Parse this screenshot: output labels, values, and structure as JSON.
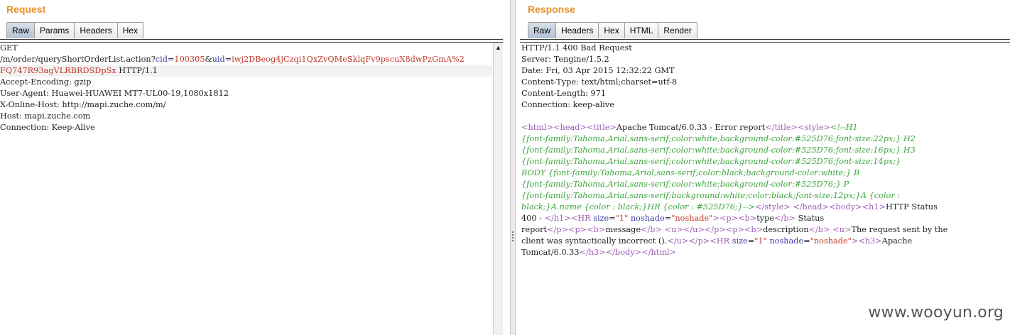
{
  "request": {
    "title": "Request",
    "tabs": [
      "Raw",
      "Params",
      "Headers",
      "Hex"
    ],
    "active_tab": "Raw",
    "line1": "GET",
    "path": "/m/order/queryShortOrderList.action?",
    "q1k": "cid",
    "q1v": "100305",
    "amp": "&",
    "eq": "=",
    "q2k": "uid",
    "q2v_part1": "iwj2DBeog4jCzqi1QxZvQMeSklqFv9pscuX8dwPzGmA%2",
    "q2v_part2": "FQ747R93agVLRBRDSDpSx",
    "protocol": " HTTP/1.1",
    "headers": [
      "Accept-Encoding: gzip",
      "User-Agent: Huawei-HUAWEI MT7-UL00-19,1080x1812",
      "X-Online-Host: http://mapi.zuche.com/m/",
      "Host: mapi.zuche.com",
      "Connection: Keep-Alive"
    ],
    "scroll_up_glyph": "▲"
  },
  "response": {
    "title": "Response",
    "tabs": [
      "Raw",
      "Headers",
      "Hex",
      "HTML",
      "Render"
    ],
    "active_tab": "Raw",
    "headers": [
      "HTTP/1.1 400 Bad Request",
      "Server: Tengine/1.5.2",
      "Date: Fri, 03 Apr 2015 12:32:22 GMT",
      "Content-Type: text/html;charset=utf-8",
      "Content-Length: 971",
      "Connection: keep-alive"
    ],
    "body": {
      "t_html": "<html>",
      "t_head": "<head>",
      "t_title": "<title>",
      "title_text": "Apache Tomcat/6.0.33 - Error report",
      "t_title_close": "</title>",
      "t_style": "<style>",
      "css_1": "<!--H1",
      "css_2": "{font-family:Tahoma,Arial,sans-serif;color:white;background-color:#525D76;font-size:22px;} H2",
      "css_3": "{font-family:Tahoma,Arial,sans-serif;color:white;background-color:#525D76;font-size:16px;} H3",
      "css_4": "{font-family:Tahoma,Arial,sans-serif;color:white;background-color:#525D76;font-size:14px;}",
      "css_5": "BODY {font-family:Tahoma,Arial,sans-serif;color:black;background-color:white;} B",
      "css_6": "{font-family:Tahoma,Arial,sans-serif;color:white;background-color:#525D76;} P",
      "css_7": "{font-family:Tahoma,Arial,sans-serif;background:white;color:black;font-size:12px;}A {color :",
      "css_8": "black;}A.name {color : black;}HR {color : #525D76;}-->",
      "t_style_close": "</style>",
      "t_head_close": "</head>",
      "t_body": "<body>",
      "t_h1": "<h1>",
      "h1_text_a": "HTTP Status",
      "h1_text_b": "400 - ",
      "t_h1_close": "</h1>",
      "t_hr_open": "<HR ",
      "a_size": "size",
      "v_size": "\"1\"",
      "a_noshade": "noshade",
      "v_noshade": "\"noshade\"",
      "t_gt": ">",
      "t_p": "<p>",
      "t_b": "<b>",
      "b_type": "type",
      "t_b_close": "</b>",
      "status_a": " Status",
      "status_b": "report",
      "t_p_close": "</p>",
      "b_message": "message",
      "t_u": "<u>",
      "t_u_close": "</u>",
      "b_description": "description",
      "desc_a": "The request sent by the",
      "desc_b": "client was syntactically incorrect ().",
      "t_h3": "<h3>",
      "h3_a": "Apache",
      "h3_b": "Tomcat/6.0.33",
      "t_h3_close": "</h3>",
      "t_body_close": "</body>",
      "t_html_close": "</html>",
      "sp": " "
    }
  },
  "watermark": "www.wooyun.org"
}
